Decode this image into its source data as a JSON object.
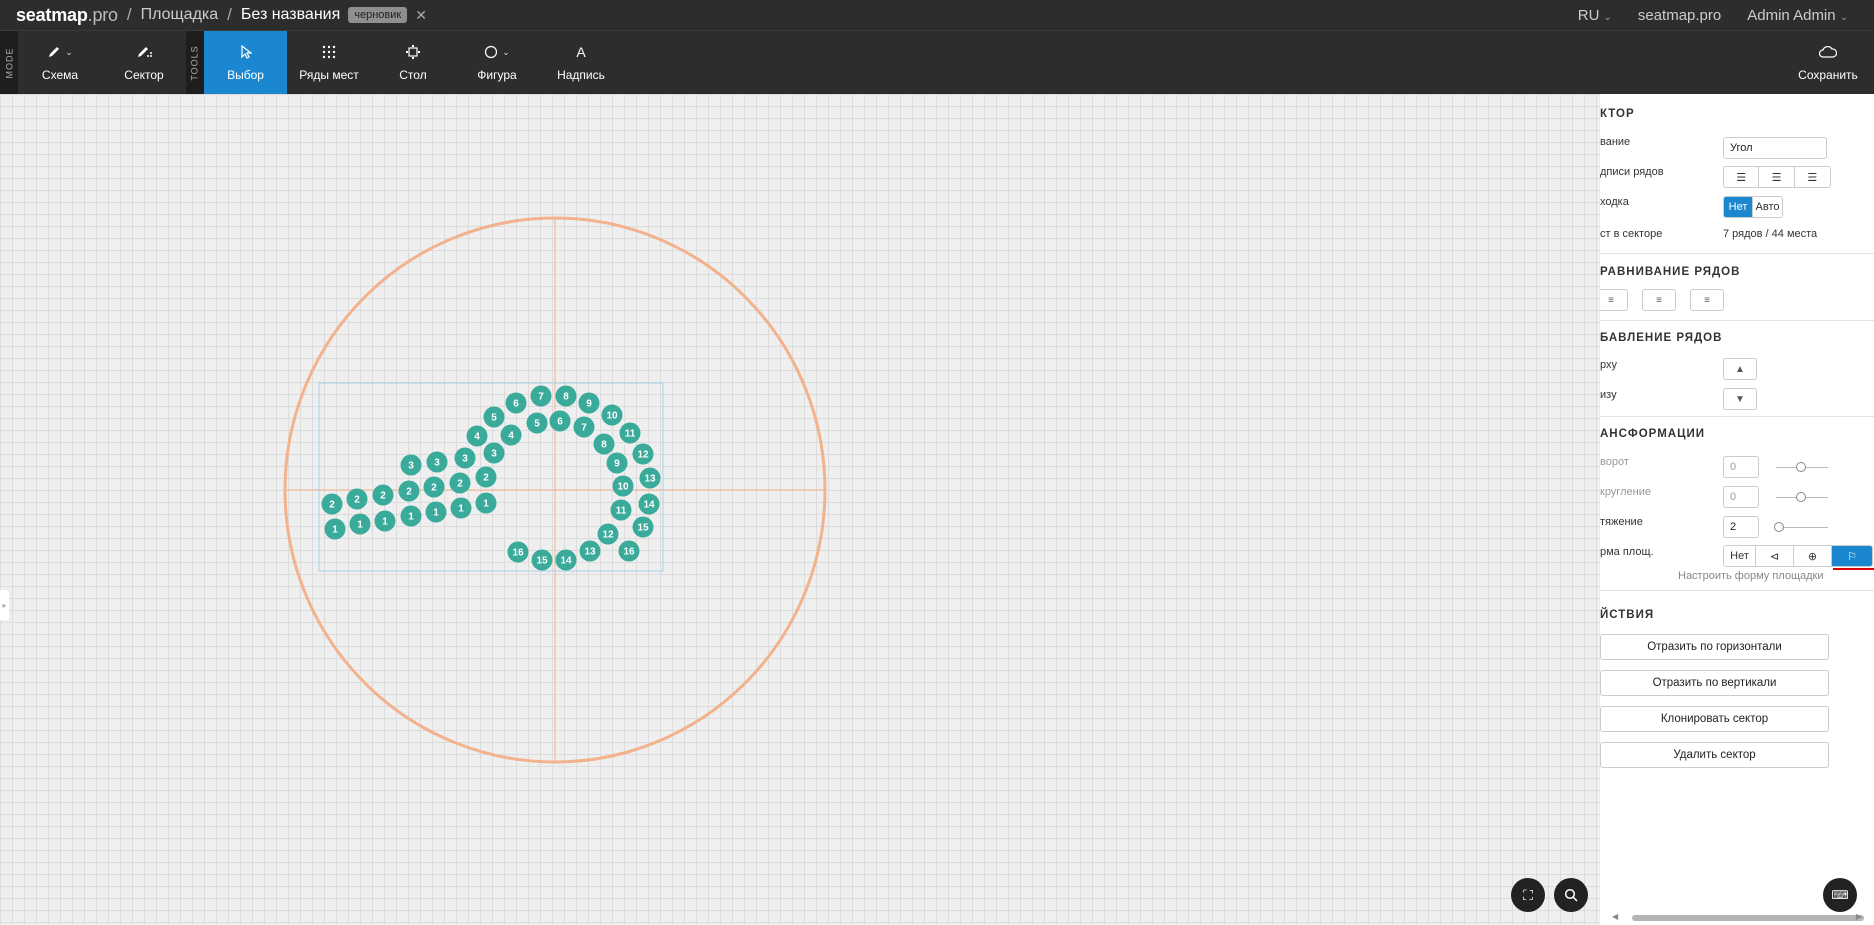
{
  "header": {
    "logo_main": "seatmap",
    "logo_suffix": ".pro",
    "sep": "/",
    "crumb_venue": "Площадка",
    "crumb_current": "Без названия",
    "badge": "черновик",
    "close": "✕",
    "lang": "RU",
    "site": "seatmap.pro",
    "user": "Admin Admin"
  },
  "toolbar": {
    "mode_label": "MODE",
    "tools_label": "TOOLS",
    "schema": "Схема",
    "sector": "Сектор",
    "select": "Выбор",
    "rows": "Ряды мест",
    "table": "Стол",
    "shape": "Фигура",
    "label": "Надпись",
    "save": "Сохранить"
  },
  "panel": {
    "sector_heading": "КТОР",
    "name_label": "вание",
    "name_value": "Угол",
    "row_labels_label": "дписи рядов",
    "lead_label": "ходка",
    "lead_options": [
      "Нет",
      "Авто"
    ],
    "seats_label": "ст в секторе",
    "seats_value": "7 рядов  /  44 места",
    "align_heading": "РАВНИВАНИЕ РЯДОВ",
    "add_rows_heading": "БАВЛЕНИЕ РЯДОВ",
    "add_top_label": "рху",
    "add_bottom_label": "изу",
    "transform_heading": "АНСФОРМАЦИИ",
    "rotate_label": "ворот",
    "rotate_value": "0",
    "round_label": "кругление",
    "round_value": "0",
    "stretch_label": "тяжение",
    "stretch_value": "2",
    "shape_label": "рма площ.",
    "shape_none": "Нет",
    "shape_link": "Настроить форму площадки",
    "actions_heading": "ЙСТВИЯ",
    "actions": [
      "Отразить по горизонтали",
      "Отразить по вертикали",
      "Клонировать сектор",
      "Удалить сектор"
    ]
  },
  "seats": {
    "row1": [
      "1",
      "1",
      "1",
      "1",
      "1",
      "1",
      "1"
    ],
    "row2": [
      "2",
      "2",
      "2",
      "2",
      "2",
      "2",
      "2"
    ],
    "row3": [
      "3",
      "3",
      "3",
      "3"
    ],
    "row4": [
      "4",
      "4"
    ],
    "row5": [
      "5",
      "5"
    ],
    "row6": [
      "6",
      "6"
    ],
    "row7": [
      "7",
      "7",
      "8",
      "9",
      "10",
      "11",
      "12",
      "13",
      "14",
      "15",
      "16",
      "8",
      "9",
      "10",
      "11",
      "12",
      "13",
      "14",
      "15",
      "16"
    ]
  }
}
